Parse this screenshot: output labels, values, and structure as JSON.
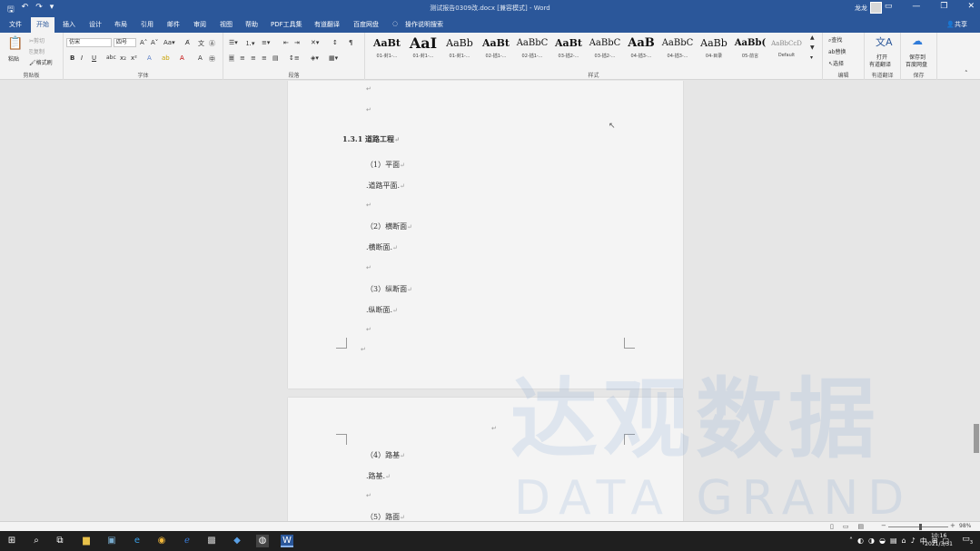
{
  "window": {
    "title": "测试报告0309改.docx [兼容模式] - Word",
    "user": "龙龙"
  },
  "tabs": [
    "文件",
    "开始",
    "插入",
    "设计",
    "布局",
    "引用",
    "邮件",
    "审阅",
    "视图",
    "帮助",
    "PDF工具集",
    "有道翻译",
    "百度网盘",
    "操作说明搜索"
  ],
  "active_tab": "开始",
  "share_label": "共享",
  "ribbon": {
    "clipboard": {
      "label": "剪贴板",
      "paste": "粘贴",
      "cut": "剪切",
      "copy": "复制",
      "format_painter": "格式刷"
    },
    "font": {
      "label": "字体",
      "font_name": "仿宋",
      "font_size": "四号"
    },
    "paragraph": {
      "label": "段落"
    },
    "styles": {
      "label": "样式",
      "items": [
        {
          "preview": "AaBt",
          "name": "01-封1-..."
        },
        {
          "preview": "AaI",
          "name": "01-封1-..."
        },
        {
          "preview": "AaBb",
          "name": "01-封1-..."
        },
        {
          "preview": "AaBt",
          "name": "02-插1-..."
        },
        {
          "preview": "AaBbC",
          "name": "02-插1-..."
        },
        {
          "preview": "AaBt",
          "name": "03-插2-..."
        },
        {
          "preview": "AaBbC",
          "name": "03-插2-..."
        },
        {
          "preview": "AaB",
          "name": "04-插3-..."
        },
        {
          "preview": "AaBbC",
          "name": "04-插3-..."
        },
        {
          "preview": "AaBb",
          "name": "04-目录"
        },
        {
          "preview": "AaBb(",
          "name": "05-前言"
        },
        {
          "preview": "AaBbCcD",
          "name": "Default"
        }
      ]
    },
    "editing": {
      "label": "编辑",
      "find": "查找",
      "replace": "替换",
      "select": "选择"
    },
    "youdao": {
      "label": "有道翻译",
      "open": "打开",
      "translate": "有道翻译"
    },
    "save": {
      "label": "保存",
      "save_to": "保存到",
      "baidu": "百度网盘"
    }
  },
  "document": {
    "heading": "1.3.1   道路工程",
    "page1_lines": [
      "（1）平面",
      ".道路平面.",
      "（2）横断面",
      ".横断面.",
      "（3）纵断面",
      ".纵断面."
    ],
    "page2_lines": [
      "（4）路基",
      ".路基.",
      "（5）路面"
    ],
    "paragraph_mark": "↵"
  },
  "watermark": {
    "cn": "达观数据",
    "en": "DATA GRAND"
  },
  "statusbar": {
    "zoom": "98%"
  },
  "taskbar": {
    "time": "10:16",
    "date": "2021/3/31",
    "ime": "中",
    "notification_count": "3"
  }
}
